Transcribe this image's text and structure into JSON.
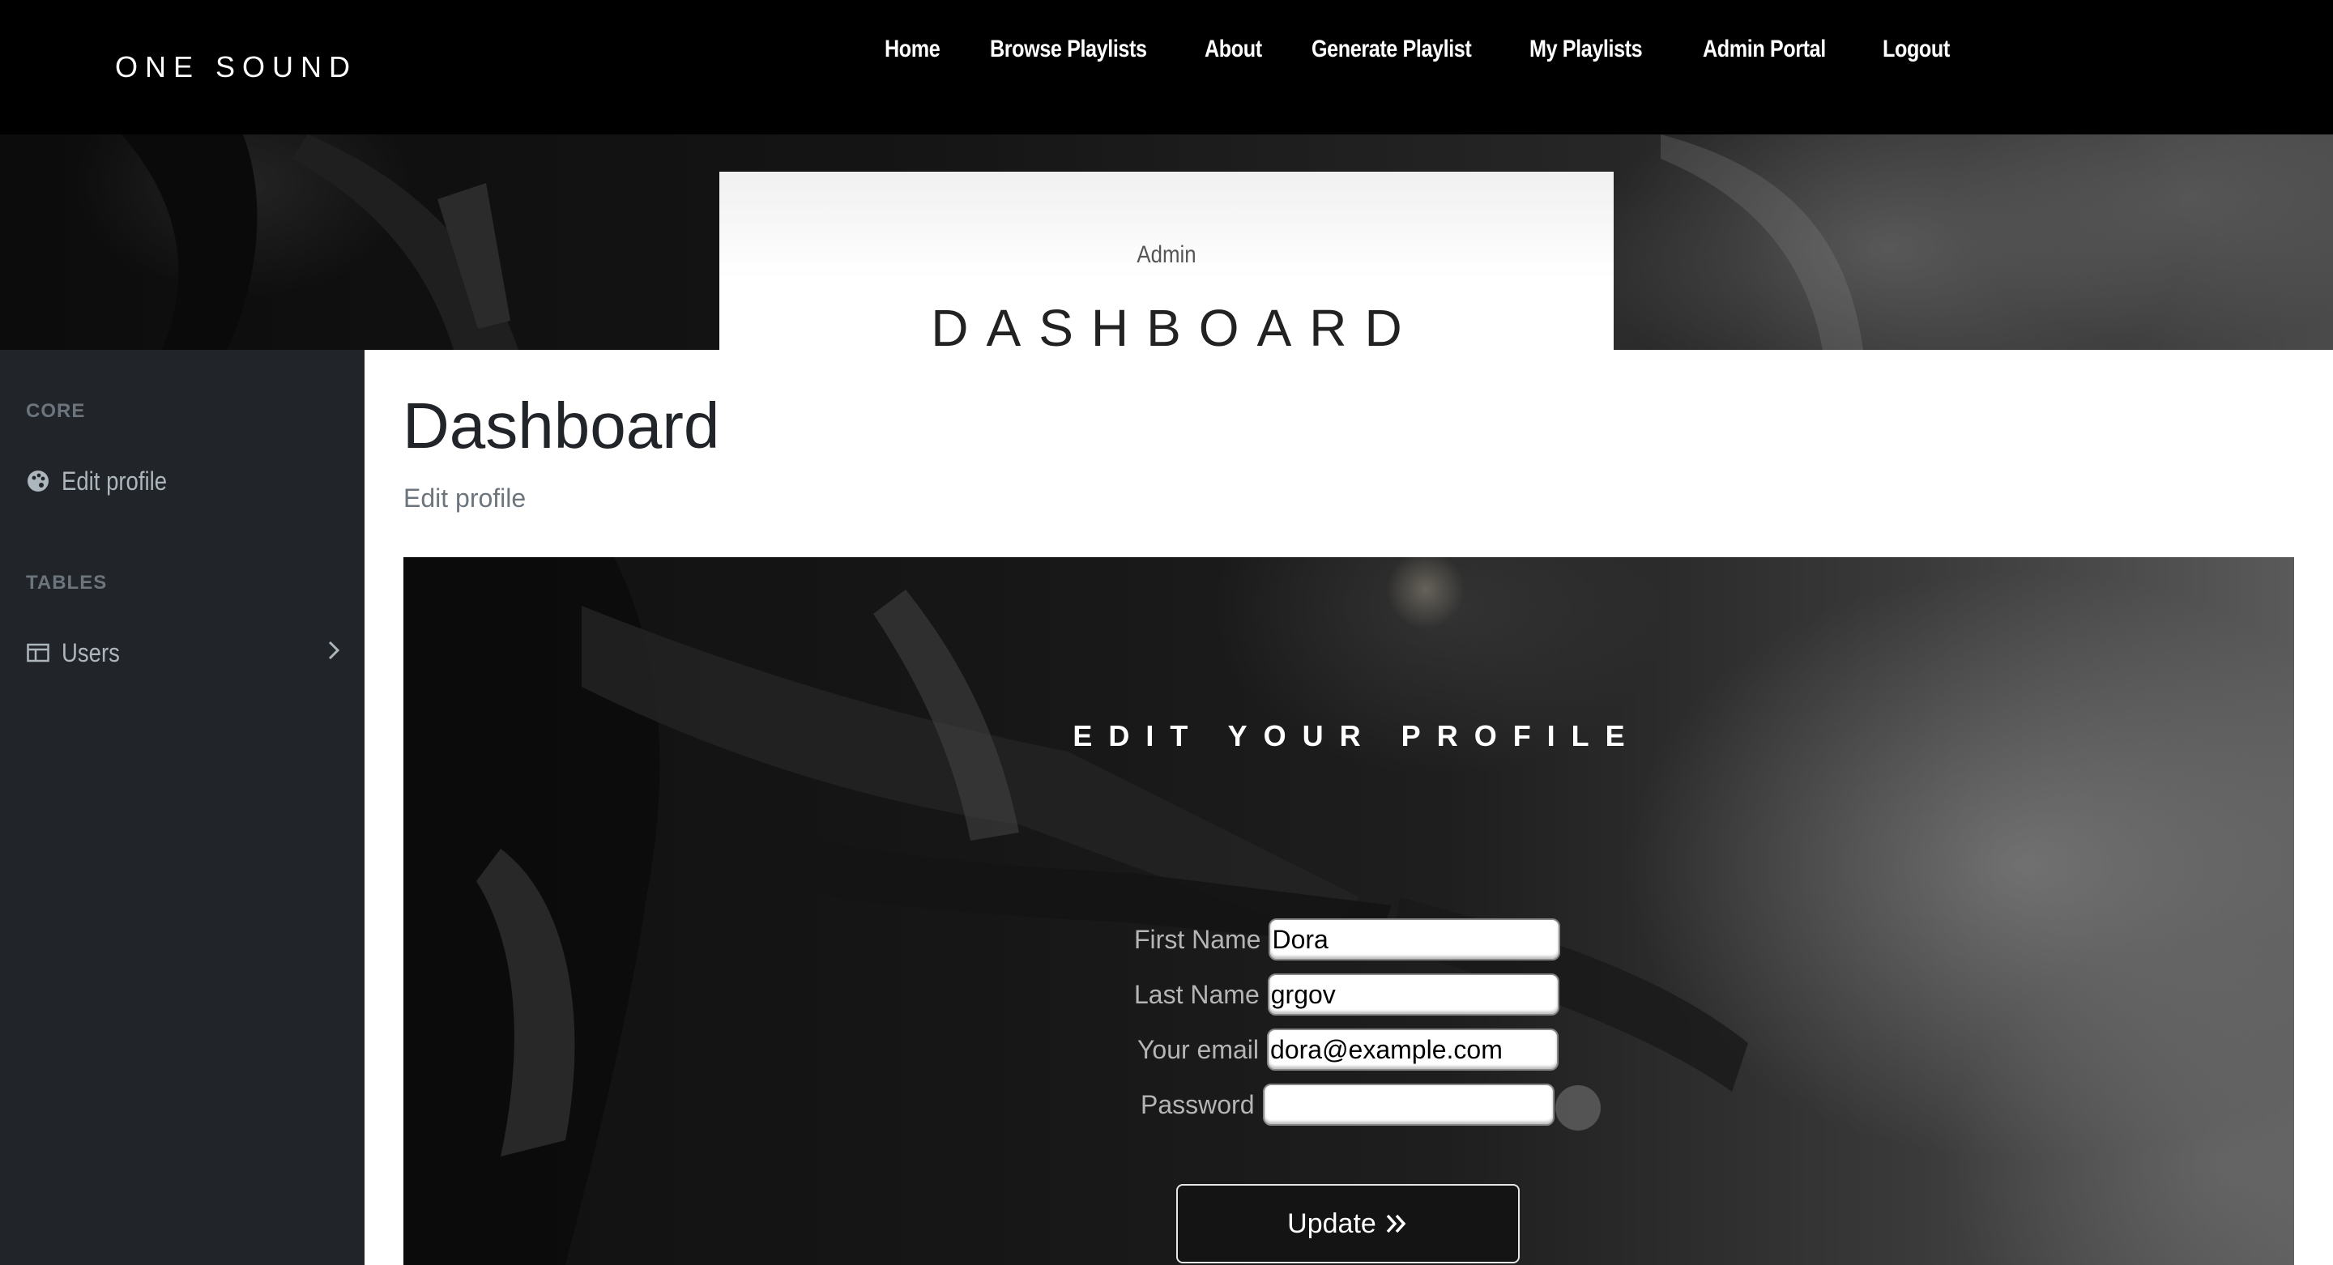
{
  "navbar": {
    "brand": "ONE SOUND",
    "links": [
      {
        "label": "Home"
      },
      {
        "label": "Browse Playlists"
      },
      {
        "label": "About"
      },
      {
        "label": "Generate Playlist"
      },
      {
        "label": "My Playlists"
      },
      {
        "label": "Admin Portal"
      },
      {
        "label": "Logout"
      }
    ]
  },
  "hero": {
    "subtitle": "Admin",
    "title": "DASHBOARD"
  },
  "sidebar": {
    "sections": [
      {
        "heading": "CORE",
        "items": [
          {
            "label": "Edit profile",
            "icon": "palette-icon"
          }
        ]
      },
      {
        "heading": "TABLES",
        "items": [
          {
            "label": "Users",
            "icon": "table-icon"
          }
        ]
      }
    ]
  },
  "main": {
    "title": "Dashboard",
    "breadcrumb": "Edit profile"
  },
  "profile_form": {
    "title": "EDIT YOUR PROFILE",
    "fields": [
      {
        "label": "First Name",
        "value": "Dora"
      },
      {
        "label": "Last Name",
        "value": "grgov"
      },
      {
        "label": "Your email",
        "value": "dora@example.com"
      },
      {
        "label": "Password",
        "value": ""
      }
    ],
    "submit_label": "Update"
  },
  "colors": {
    "navbar_bg": "#000000",
    "sidebar_bg": "#212529",
    "sidebar_text": "#adb5bd",
    "sidebar_heading": "#6c757d"
  }
}
